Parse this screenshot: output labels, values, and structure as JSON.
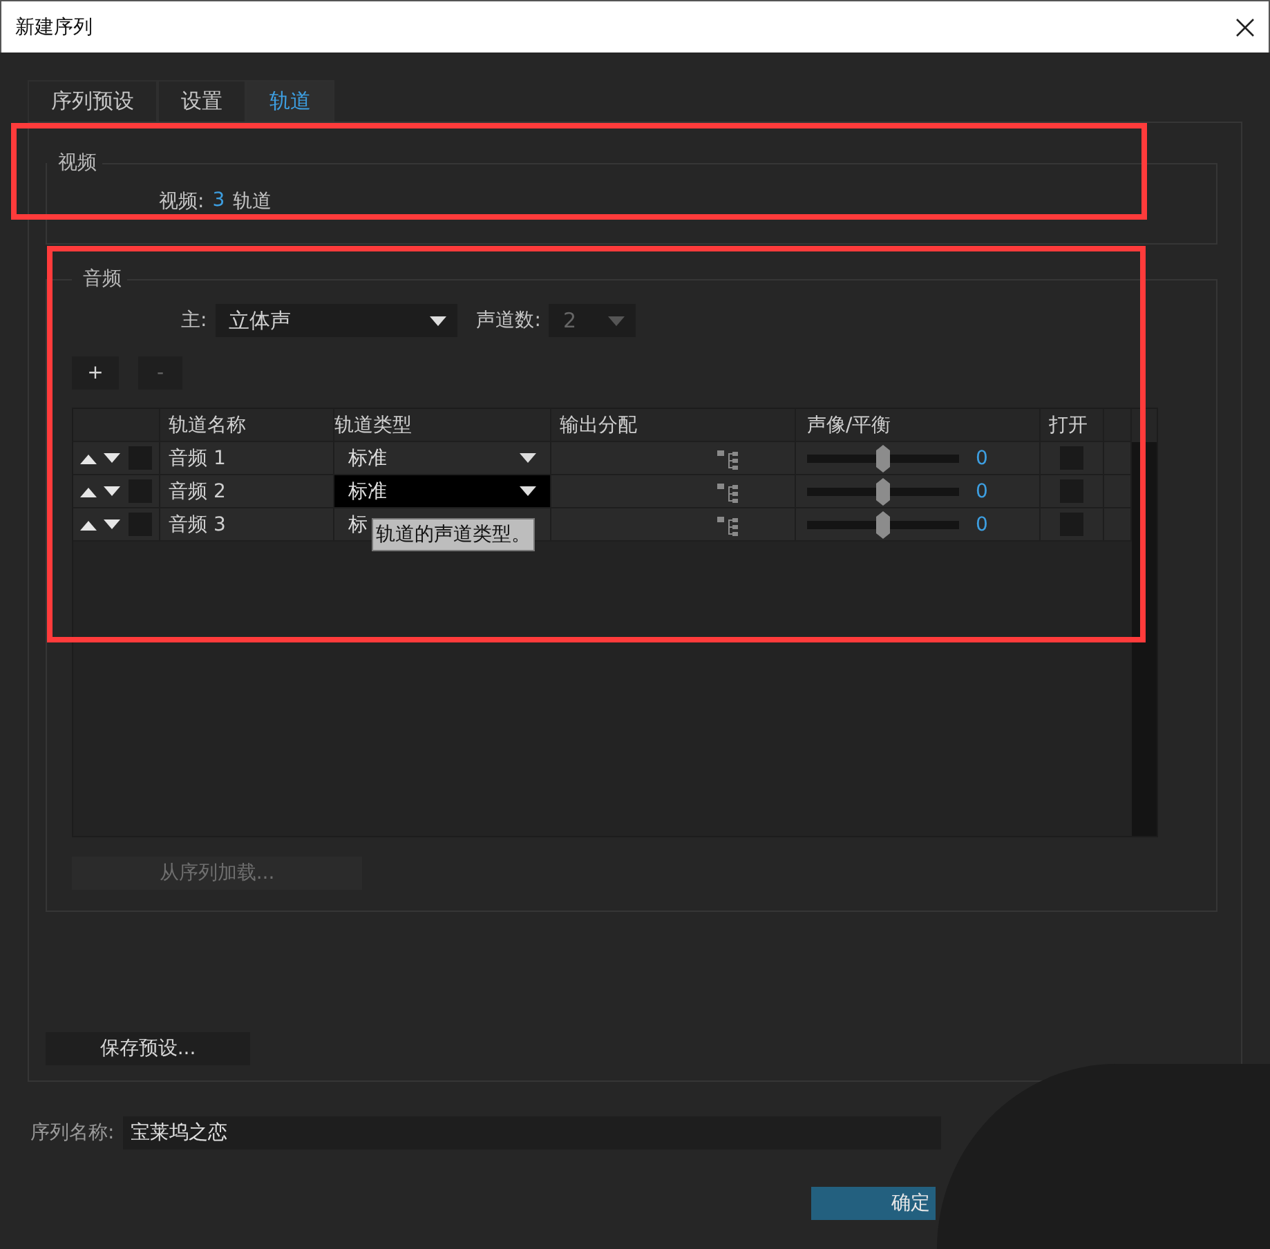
{
  "window": {
    "title": "新建序列"
  },
  "tabs": [
    {
      "label": "序列预设",
      "selected": false
    },
    {
      "label": "设置",
      "selected": false
    },
    {
      "label": "轨道",
      "selected": true
    }
  ],
  "video": {
    "highlighted": true,
    "title": "视频",
    "label": "视频:",
    "count": "3",
    "unit": "轨道"
  },
  "audio": {
    "highlighted": true,
    "title": "音频",
    "master_label": "主:",
    "master": {
      "value": "立体声",
      "disabled": false
    },
    "channels_label": "声道数:",
    "channels": {
      "value": "2",
      "disabled": true
    },
    "buttons": [
      {
        "label": "+",
        "disabled": false
      },
      {
        "label": "-",
        "disabled": true
      }
    ],
    "columns": [
      "轨道名称",
      "轨道类型",
      "输出分配",
      "声像/平衡",
      "打开"
    ],
    "rows": [
      {
        "name": "音频 1",
        "type": "标准",
        "type_focused": false,
        "type_arrow": true,
        "level": 0.5,
        "reading": "0",
        "open": false
      },
      {
        "name": "音频 2",
        "type": "标准",
        "type_focused": true,
        "type_arrow": true,
        "level": 0.5,
        "reading": "0",
        "open": false
      },
      {
        "name": "音频 3",
        "type": "标",
        "type_focused": false,
        "type_arrow": false,
        "level": 0.5,
        "reading": "0",
        "open": false
      }
    ],
    "tooltip": "轨道的声道类型。",
    "load_button": {
      "label": "从序列加载...",
      "disabled": true
    }
  },
  "save_preset": "保存预设...",
  "sequence_name": {
    "label": "序列名称:",
    "value": "宝莱坞之恋"
  },
  "ok_button": "确定"
}
